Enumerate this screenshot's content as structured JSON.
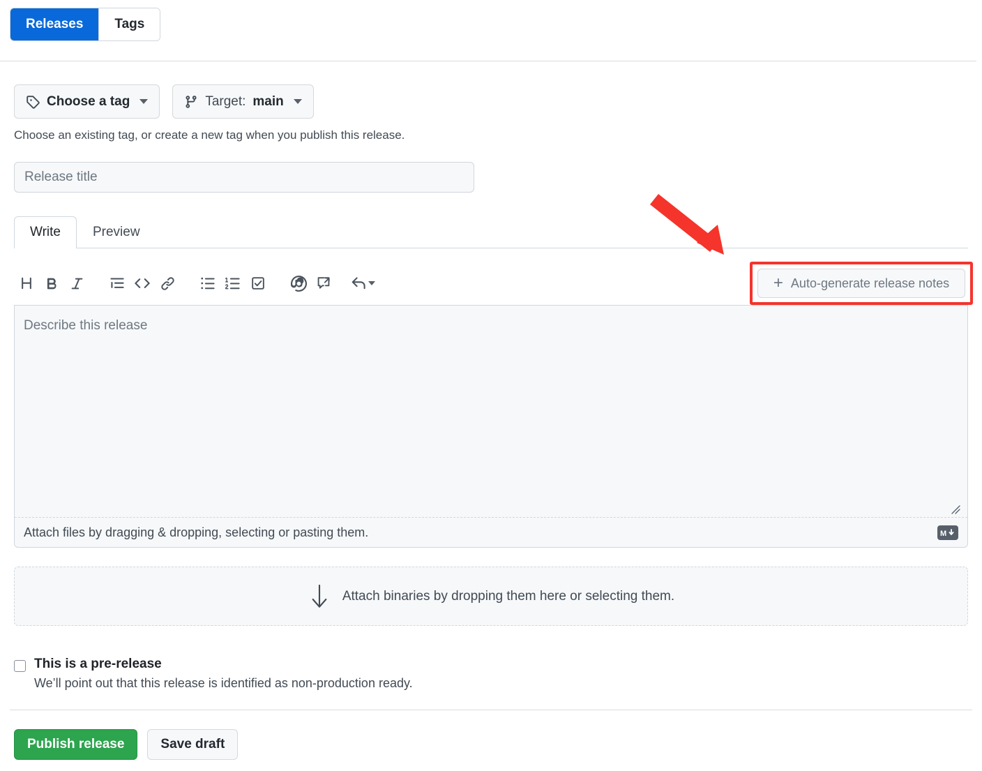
{
  "tabs": {
    "releases_label": "Releases",
    "tags_label": "Tags",
    "active": "Releases"
  },
  "pickers": {
    "tag_label": "Choose a tag",
    "target_prefix": "Target:",
    "target_value": "main",
    "helper_text": "Choose an existing tag, or create a new tag when you publish this release."
  },
  "release_title": {
    "value": "",
    "placeholder": "Release title"
  },
  "editor": {
    "tab_write": "Write",
    "tab_preview": "Preview",
    "active_tab": "Write",
    "body_value": "",
    "body_placeholder": "Describe this release",
    "attach_files_text": "Attach files by dragging & dropping, selecting or pasting them.",
    "markdown_badge": "M",
    "toolbar": [
      {
        "name": "heading-icon",
        "title": "Heading"
      },
      {
        "name": "bold-icon",
        "title": "Bold"
      },
      {
        "name": "italic-icon",
        "title": "Italic"
      },
      {
        "name": "quote-icon",
        "title": "Quote"
      },
      {
        "name": "code-icon",
        "title": "Code"
      },
      {
        "name": "link-icon",
        "title": "Link"
      },
      {
        "name": "unordered-list-icon",
        "title": "Bulleted list"
      },
      {
        "name": "ordered-list-icon",
        "title": "Numbered list"
      },
      {
        "name": "task-list-icon",
        "title": "Task list"
      },
      {
        "name": "mention-icon",
        "title": "Mention"
      },
      {
        "name": "cross-reference-icon",
        "title": "Reference"
      },
      {
        "name": "saved-reply-icon",
        "title": "Saved replies"
      }
    ]
  },
  "autogen": {
    "label": "Auto-generate release notes",
    "plus": "+"
  },
  "dropzone": {
    "text": "Attach binaries by dropping them here or selecting them."
  },
  "prerelease": {
    "label": "This is a pre-release",
    "description": "We’ll point out that this release is identified as non-production ready.",
    "checked": false
  },
  "footer": {
    "publish_label": "Publish release",
    "draft_label": "Save draft"
  },
  "colors": {
    "accent_blue": "#0969da",
    "success_green": "#2da44e",
    "annotation_red": "#f5342c",
    "border_gray": "#d0d7de",
    "surface_gray": "#f6f8fa",
    "text_primary": "#1f2328",
    "text_muted": "#6e7781"
  }
}
